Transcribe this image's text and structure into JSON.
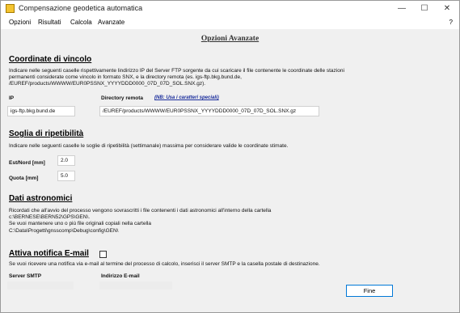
{
  "window": {
    "title": "Compensazione geodetica automatica",
    "controls": {
      "minimize": "—",
      "maximize": "☐",
      "close": "✕"
    }
  },
  "menu": {
    "items": [
      "Opzioni",
      "Risultati",
      "Calcola",
      "Avanzate"
    ],
    "help": "?"
  },
  "page_title": "Opzioni Avanzate",
  "sections": {
    "coordinate": {
      "title": "Coordinate di vincolo",
      "description": "Indicare nelle seguenti caselle rispettivamente lindirizzo IP del Server FTP sorgente da cui scaricare il file contenente le coordinate delle stazioni permanenti considerate come vincolo in formato SNX, e la directory remota (es. igs-ftp.bkg.bund.de, /EUREF/products/WWWW/EUR0PSSNX_YYYYDDD0000_07D_07D_SOL.SNX.gz).",
      "ip_label": "IP",
      "dir_label": "Directory remota",
      "dir_note": "(NB: Usa i caratteri speciali)",
      "ip_value": "igs-ftp.bkg.bund.de",
      "dir_value": "/EUREF/products/WWWW/EUR0PSSNX_YYYYDDD0000_07D_07D_SOL.SNX.gz"
    },
    "soglia": {
      "title": "Soglia di ripetibilità",
      "description": "Indicare nelle seguenti caselle le soglie di ripetibilità (settimanale) massima per considerare valide le coordinate stimate.",
      "est_label": "Est/Nord [mm]",
      "est_value": "2.0",
      "quota_label": "Quota [mm]",
      "quota_value": "5.0"
    },
    "astronomici": {
      "title": "Dati astronomici",
      "lines": [
        "Ricordati che all'avvio del processo vengono sovrascritti i file contenenti i dati astronomici all'interno della cartella",
        "c:\\BERNESE\\BERN52\\GPS\\GEN\\.",
        "Se vuoi mantenere uno o più file originali copiali nella cartella",
        "C:\\Data\\Progetti\\gnsscomp\\Debug\\config\\GEN\\"
      ]
    },
    "notifica": {
      "title": "Attiva notifica E-mail",
      "checked": false,
      "description": "Se vuoi ricevere una notifica via e-mail al termine del processo di calcolo, inserisci il server SMTP e la casella postale di destinazione.",
      "smtp_label": "Server SMTP",
      "email_label": "Indirizzo E-mail",
      "smtp_value": "",
      "email_value": ""
    }
  },
  "buttons": {
    "fine": "Fine"
  },
  "colors": {
    "accent": "#0078d7",
    "link": "#1a2d9c",
    "panel": "#f0f0f0"
  }
}
